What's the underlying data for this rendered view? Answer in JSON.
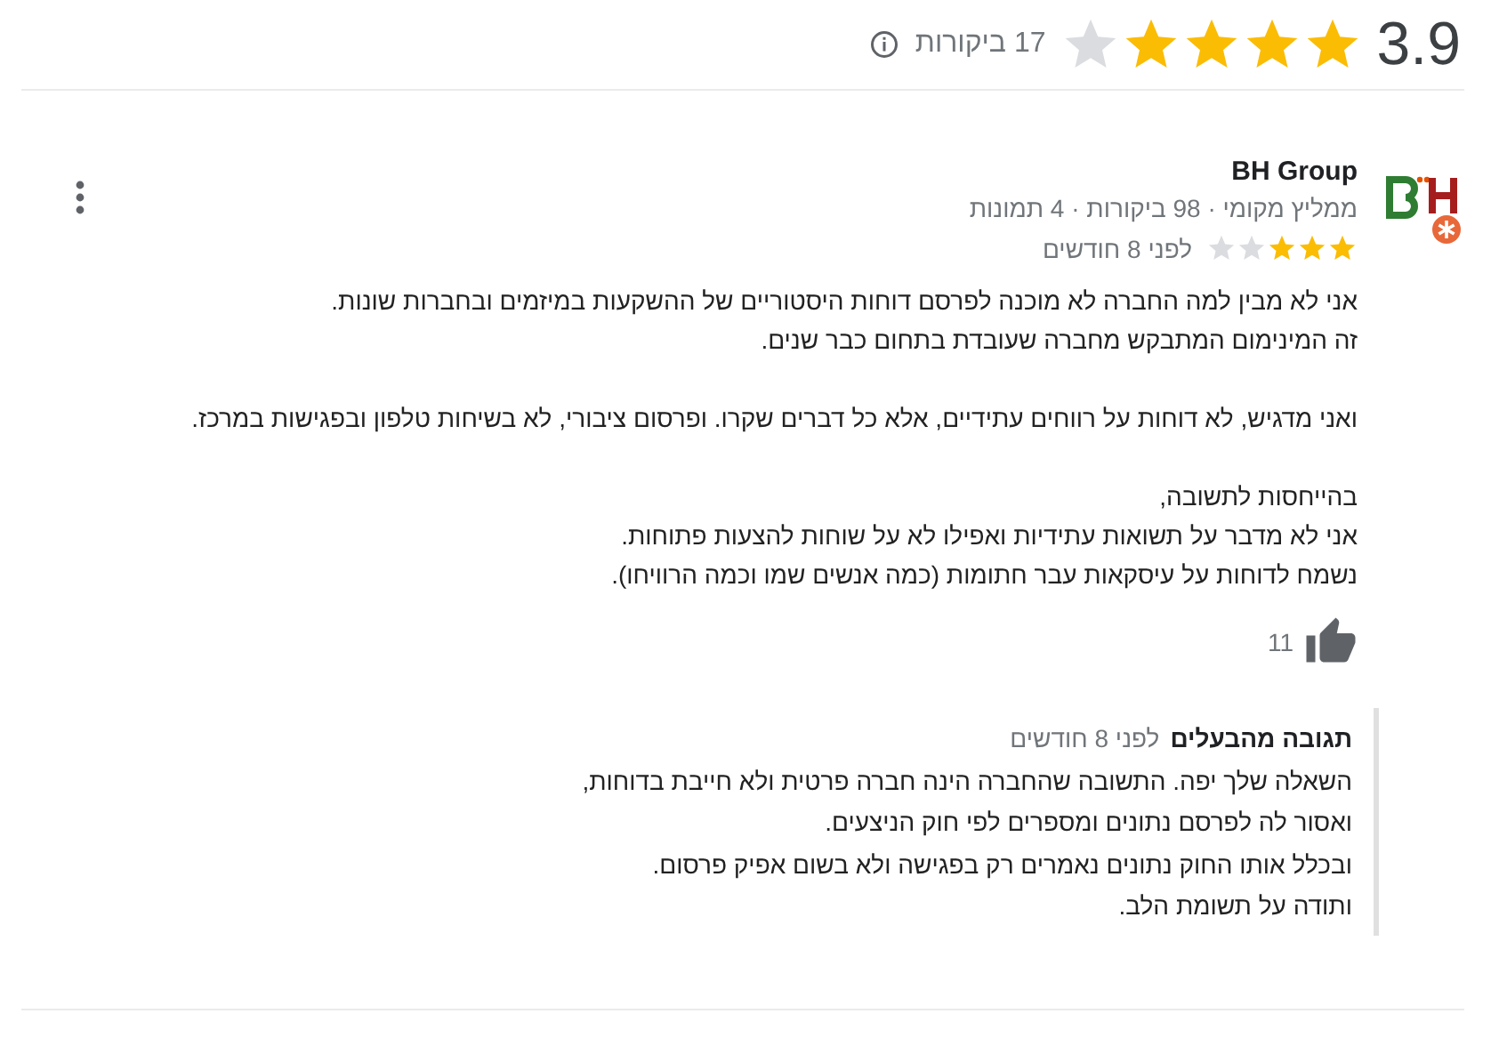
{
  "summary": {
    "rating": "3.9",
    "stars": 4,
    "review_count": "17 ביקורות"
  },
  "review": {
    "author": "BH Group",
    "author_meta": "ממליץ מקומי · 98 ביקורות · 4 תמונות",
    "stars": 3,
    "time": "לפני 8 חודשים",
    "paragraphs": [
      [
        "אני לא מבין למה החברה לא מוכנה לפרסם דוחות היסטוריים של ההשקעות במיזמים ובחברות שונות.",
        "זה המינימום המתבקש מחברה שעובדת בתחום כבר שנים."
      ],
      [
        "ואני מדגיש, לא דוחות על רווחים עתידיים, אלא כל דברים שקרו. ופרסום ציבורי, לא בשיחות טלפון ובפגישות במרכז."
      ],
      [
        "בהייחסות לתשובה,",
        "אני לא מדבר על תשואות עתידיות ואפילו לא על שוחות להצעות פתוחות.",
        "נשמח לדוחות על עיסקאות עבר חתומות (כמה אנשים שמו וכמה הרוויחו)."
      ]
    ],
    "likes": "11",
    "owner_reply": {
      "label": "תגובה מהבעלים",
      "time": "לפני 8 חודשים",
      "lines": [
        "השאלה שלך יפה. התשובה שהחברה הינה חברה פרטית ולא חייבת בדוחות,",
        "ואסור לה לפרסם נתונים ומספרים לפי חוק הניצעים.",
        "ובכלל אותו החוק נתונים נאמרים רק בפגישה ולא בשום אפיק פרסום.",
        "ותודה על תשומת הלב."
      ]
    }
  }
}
